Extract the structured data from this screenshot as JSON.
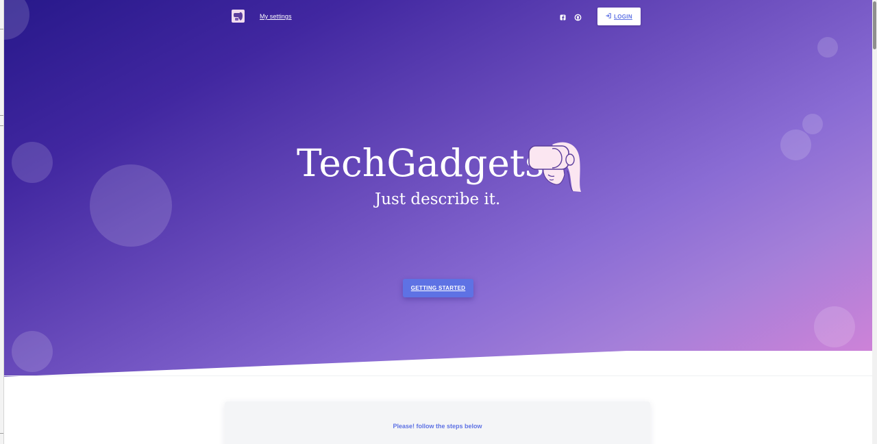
{
  "nav": {
    "logo_icon": "vr-headset-girl-icon",
    "settings_link": "My settings",
    "social": [
      "facebook-icon",
      "github-icon"
    ],
    "login_label": "LOGIN",
    "login_icon": "sign-in-icon"
  },
  "hero": {
    "title": "TechGadgets",
    "subtitle": "Just describe it.",
    "mascot_icon": "vr-headset-girl-icon",
    "cta_label": "GETTING STARTED"
  },
  "steps_card": {
    "text": "Please! follow the steps below"
  },
  "colors": {
    "accent": "#5e72e4",
    "gradient_start": "#27188a",
    "gradient_end": "#d583d8",
    "mascot": "#fbe6f1"
  }
}
